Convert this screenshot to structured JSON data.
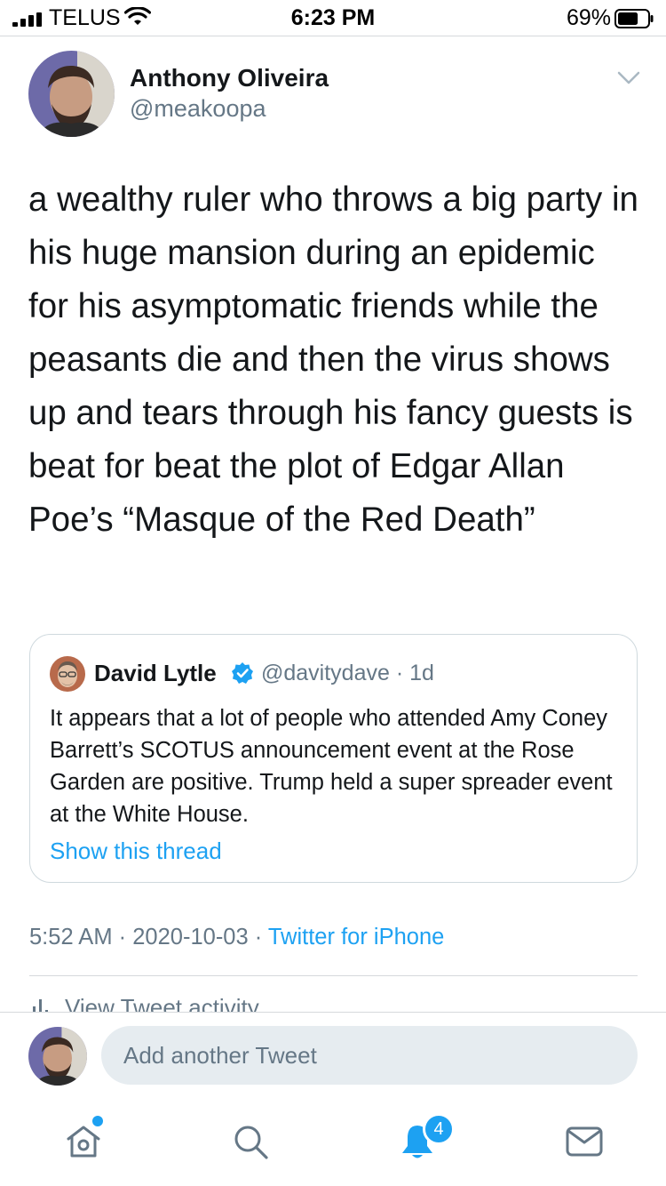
{
  "status_bar": {
    "carrier": "TELUS",
    "time": "6:23 PM",
    "battery_percent": "69%",
    "battery_level": 0.69,
    "icons": [
      "signal-icon",
      "wifi-icon",
      "battery-icon"
    ]
  },
  "tweet": {
    "author_name": "Anthony Oliveira",
    "author_handle": "@meakoopa",
    "text": "a wealthy ruler who throws a big party in his huge mansion during an epidemic for his asymptomatic friends while the peasants die and then the virus shows up and tears through his fancy guests is beat for beat the plot of Edgar Allan Poe’s “Masque of the Red Death”",
    "time": "5:52 AM",
    "date": "2020-10-03",
    "separator": " · ",
    "source": "Twitter for iPhone"
  },
  "quote": {
    "author_name": "David Lytle",
    "author_handle": "@davitydave · 1d",
    "text": "It appears that a lot of people who attended Amy Coney Barrett’s SCOTUS announcement event at the Rose Garden are positive. Trump held a super spreader event at the White House.",
    "show_thread": "Show this thread"
  },
  "activity": {
    "label": "View Tweet activity"
  },
  "reply": {
    "placeholder": "Add another Tweet"
  },
  "tab_bar": {
    "tabs": [
      "home-icon",
      "search-icon",
      "notifications-icon",
      "messages-icon"
    ],
    "notification_count": "4"
  },
  "colors": {
    "accent": "#1da1f2",
    "secondary_text": "#657786",
    "input_background": "#e6ecf0"
  }
}
